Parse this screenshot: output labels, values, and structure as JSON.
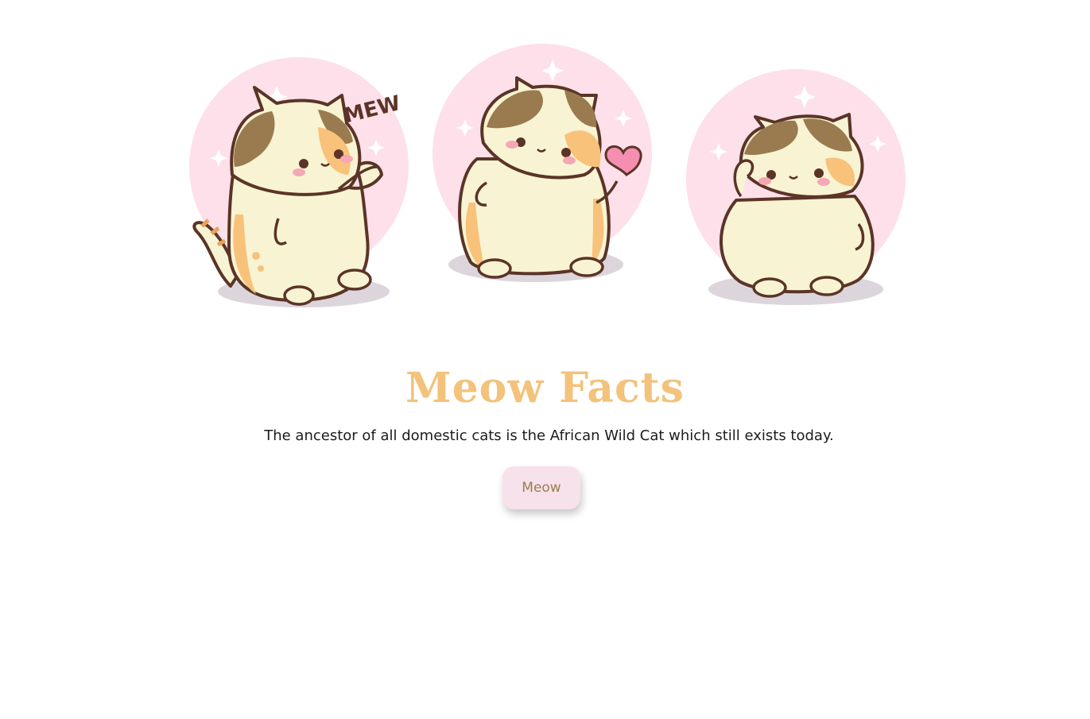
{
  "illustration": {
    "mew_text": "MEW",
    "colors": {
      "circle": "#fde0ea",
      "body": "#f8f4d3",
      "patch_brown": "#9a7b4f",
      "patch_orange": "#f8c27b",
      "outline": "#5b3427",
      "blush": "#f6a7b4",
      "heart": "#f48fb1",
      "shadow": "#ddd5dc"
    },
    "icons": [
      "cat-mew",
      "cat-heart",
      "cat-wave"
    ]
  },
  "title": "Meow Facts",
  "fact": "The ancestor of all domestic cats is the African Wild Cat which still exists today.",
  "button": {
    "label": "Meow"
  },
  "theme": {
    "title_color": "#f3c27b",
    "button_bg": "#f7e1ea",
    "button_text": "#9b7d55"
  }
}
